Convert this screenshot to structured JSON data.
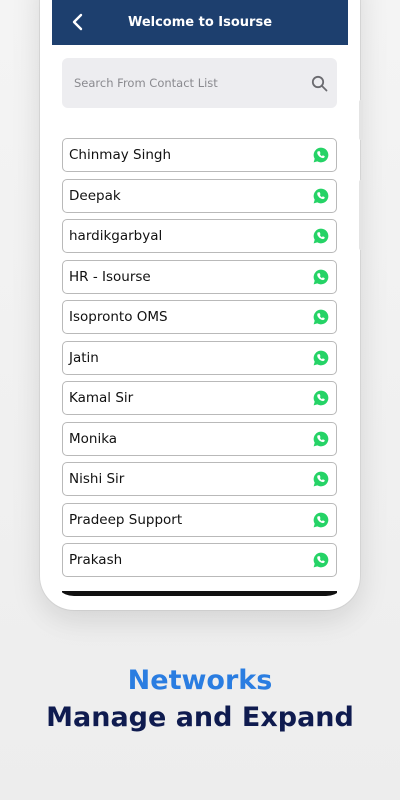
{
  "header": {
    "title": "Welcome to Isourse"
  },
  "search": {
    "placeholder": "Search From Contact List",
    "value": ""
  },
  "contacts": [
    {
      "name": "Chinmay Singh"
    },
    {
      "name": "Deepak"
    },
    {
      "name": "hardikgarbyal"
    },
    {
      "name": "HR - Isourse"
    },
    {
      "name": "Isopronto OMS"
    },
    {
      "name": "Jatin"
    },
    {
      "name": "Kamal Sir"
    },
    {
      "name": "Monika"
    },
    {
      "name": "Nishi Sir"
    },
    {
      "name": "Pradeep Support"
    },
    {
      "name": "Prakash"
    }
  ],
  "icons": {
    "back": "back-arrow-icon",
    "search": "search-icon",
    "contact_action": "whatsapp-icon"
  },
  "colors": {
    "header": "#1d3f6e",
    "whatsapp": "#25d366",
    "tagline_accent": "#2a7de1",
    "tagline_dark": "#0f1b4f"
  },
  "tagline": {
    "line1": "Networks",
    "line2": "Manage and Expand"
  }
}
